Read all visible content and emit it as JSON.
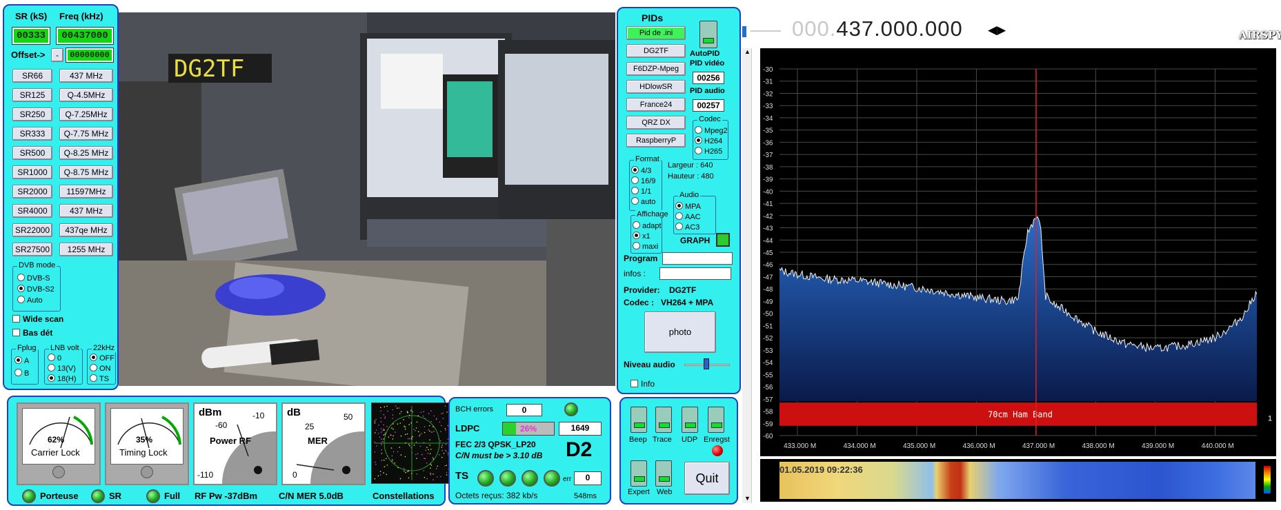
{
  "left_panel": {
    "sr_header": "SR (kS)",
    "freq_header": "Freq (kHz)",
    "sr_value": "00333",
    "freq_value": "00437000",
    "offset_label": "Offset->",
    "offset_sign": "-",
    "offset_value": "00000000",
    "sr_buttons": [
      "SR66",
      "SR125",
      "SR250",
      "SR333",
      "SR500",
      "SR1000",
      "SR2000",
      "SR4000",
      "SR22000",
      "SR27500"
    ],
    "freq_buttons": [
      "437 MHz",
      "Q-4.5MHz",
      "Q-7.25MHz",
      "Q-7.75 MHz",
      "Q-8.25 MHz",
      "Q-8.75 MHz",
      "11597MHz",
      "437 MHz",
      "437qe MHz",
      "1255 MHz"
    ],
    "dvb_mode_title": "DVB mode",
    "dvb_modes": [
      "DVB-S",
      "DVB-S2",
      "Auto"
    ],
    "dvb_selected": "DVB-S2",
    "wide_scan": "Wide scan",
    "bas_det": "Bas dét",
    "fplug_title": "Fplug",
    "fplug_opts": [
      "A",
      "B"
    ],
    "lnb_title": "LNB volt",
    "lnb_opts": [
      "0",
      "13(V)",
      "18(H)"
    ],
    "khz_title": "22kHz",
    "khz_opts": [
      "OFF",
      "ON",
      "TS"
    ]
  },
  "video": {
    "callsign_overlay": "DG2TF"
  },
  "pids_panel": {
    "title": "PIDs",
    "buttons": [
      "Pid de .ini",
      "DG2TF",
      "F6DZP-Mpeg",
      "HDlowSR",
      "France24",
      "QRZ DX",
      "RaspberryP"
    ],
    "autopid": "AutoPID",
    "pid_video_label": "PID vidéo",
    "pid_video": "00256",
    "pid_audio_label": "PID audio",
    "pid_audio": "00257",
    "codec_title": "Codec",
    "codecs": [
      "Mpeg2",
      "H264",
      "H265"
    ],
    "format_title": "Format",
    "formats": [
      "4/3",
      "16/9",
      "1/1",
      "auto"
    ],
    "largeur": "Largeur :  640",
    "hauteur": "Hauteur :  480",
    "affichage_title": "Affichage",
    "affichage": [
      "adapt",
      "x1",
      "maxi"
    ],
    "audio_title": "Audio",
    "audios": [
      "MPA",
      "AAC",
      "AC3"
    ],
    "graph": "GRAPH",
    "program_label": "Program",
    "infos_label": "infos :",
    "provider_label": "Provider:",
    "provider_value": "DG2TF",
    "codec_label": "Codec :",
    "codec_value": "VH264 + MPA",
    "photo": "photo",
    "niveau_audio": "Niveau audio",
    "info_chk": "Info"
  },
  "bottom": {
    "meter1_pct": "62%",
    "meter1_label": "Carrier Lock",
    "meter2_pct": "35%",
    "meter2_label": "Timing Lock",
    "power_title": "dBm",
    "power_label": "Power RF",
    "power_ticks": [
      "-60",
      "-10",
      "-110"
    ],
    "mer_title": "dB",
    "mer_label": "MER",
    "mer_ticks": [
      "25",
      "50",
      "0"
    ],
    "leds": [
      "Porteuse",
      "SR",
      "Full"
    ],
    "rf_pw": "RF Pw -37dBm",
    "cn_mer": "C/N MER 5.0dB",
    "constellations": "Constellations"
  },
  "status_panel": {
    "bch_label": "BCH errors",
    "bch_value": "0",
    "ldpc_label": "LDPC",
    "ldpc_pct": "26%",
    "ldpc_value": "1649",
    "fec_line": "FEC  2/3 QPSK_LP20",
    "cn_line": "C/N must be > 3.10 dB",
    "big_code": "D2",
    "ts_label": "TS",
    "err_label": "err",
    "err_value": "0",
    "octets": "Octets reçus: 382 kb/s",
    "ms": "548ms"
  },
  "control_panel": {
    "switches": [
      "Beep",
      "Trace",
      "UDP",
      "Enregst",
      "Expert",
      "Web"
    ],
    "quit": "Quit"
  },
  "sdr": {
    "freq_dim": "000.",
    "freq_main": "437.000.000",
    "logo": "AIRSPY",
    "y_ticks": [
      "-30",
      "-31",
      "-32",
      "-33",
      "-34",
      "-35",
      "-36",
      "-37",
      "-38",
      "-39",
      "-40",
      "-41",
      "-42",
      "-43",
      "-44",
      "-45",
      "-46",
      "-47",
      "-48",
      "-49",
      "-50",
      "-51",
      "-52",
      "-53",
      "-54",
      "-55",
      "-56",
      "-57",
      "-58",
      "-59",
      "-60"
    ],
    "x_ticks": [
      "433.000 M",
      "434.000 M",
      "435.000 M",
      "436.000 M",
      "437.000 M",
      "438.000 M",
      "439.000 M",
      "440.000 M"
    ],
    "band_label": "70cm Ham Band",
    "zoom": "1",
    "timestamp": "01.05.2019 09:22:36",
    "accent": "#cc1010"
  },
  "chart_data": {
    "type": "line",
    "x_unit": "MHz",
    "ylim": [
      -60,
      -30
    ],
    "xlim": [
      432.7,
      440.7
    ],
    "x": [
      432.7,
      433.0,
      433.5,
      434.0,
      434.5,
      435.0,
      435.5,
      436.0,
      436.5,
      436.7,
      436.85,
      436.95,
      437.0,
      437.08,
      437.15,
      437.3,
      437.5,
      438.0,
      438.5,
      439.0,
      439.5,
      440.0,
      440.3,
      440.5,
      440.7
    ],
    "series": [
      {
        "values": [
          -46.5,
          -46.8,
          -47.2,
          -47.3,
          -47.6,
          -47.9,
          -48.3,
          -48.7,
          -49.0,
          -48.8,
          -43.5,
          -42.5,
          -42.0,
          -43.0,
          -48.5,
          -49.3,
          -49.8,
          -51.5,
          -52.5,
          -52.9,
          -52.6,
          -52.0,
          -51.0,
          -50.0,
          -48.2
        ]
      }
    ],
    "marker_x": 437.0,
    "grid": true
  }
}
